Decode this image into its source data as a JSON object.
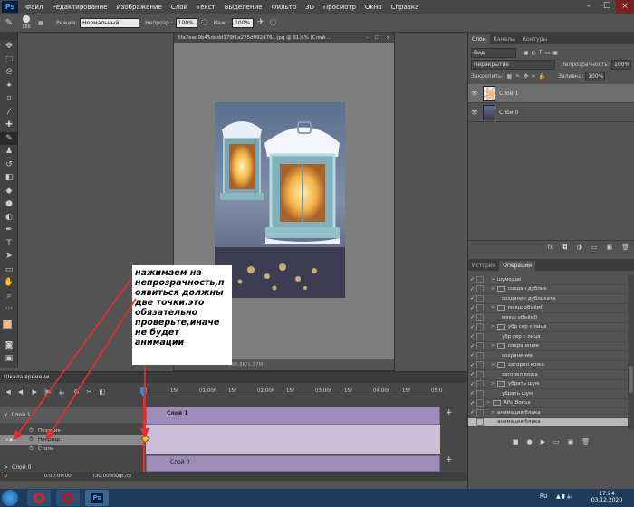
{
  "app": {
    "logo": "Ps"
  },
  "menu": [
    "Файл",
    "Редактирование",
    "Изображение",
    "Слои",
    "Текст",
    "Выделение",
    "Фильтр",
    "3D",
    "Просмотр",
    "Окно",
    "Справка"
  ],
  "options_bar": {
    "brush_size": "188",
    "mode_label": "Режим:",
    "mode_value": "Нормальный",
    "opacity_label": "Непрозр.:",
    "opacity_value": "100%",
    "pressure_label": "Наж.:",
    "pressure_value": "100%"
  },
  "document": {
    "title": "5fa7ead9b45dadd179f1a225d0924761.jpg @ 61,6% (Слой ...",
    "status": "798.8K/1.37M"
  },
  "layers_panel": {
    "tabs": [
      "Слои",
      "Каналы",
      "Контуры"
    ],
    "kind": "Вид",
    "blend": "Перекрытие",
    "opacity_label": "Непрозрачность:",
    "opacity_value": "100%",
    "lock_label": "Закрепить:",
    "fill_label": "Заливка:",
    "fill_value": "100%",
    "layers": [
      {
        "name": "Слой 1",
        "selected": true
      },
      {
        "name": "Слой 0",
        "selected": false
      }
    ],
    "footer_icons": [
      "fx",
      "◘",
      "◑",
      "▭",
      "▣",
      "🗑"
    ]
  },
  "actions_panel": {
    "tabs": [
      "История",
      "Операции"
    ],
    "items": [
      {
        "label": "шумодав",
        "indent": 1,
        "folder": false
      },
      {
        "label": "создан дублик",
        "indent": 1,
        "folder": true
      },
      {
        "label": "создание дубликата",
        "indent": 2,
        "folder": false
      },
      {
        "label": "мякш объём0",
        "indent": 1,
        "folder": true
      },
      {
        "label": "мякш объём0",
        "indent": 2,
        "folder": false
      },
      {
        "label": "убр сер с лица",
        "indent": 1,
        "folder": true
      },
      {
        "label": "убр сер с лица",
        "indent": 2,
        "folder": false
      },
      {
        "label": "сохранение",
        "indent": 1,
        "folder": true
      },
      {
        "label": "сохранение",
        "indent": 2,
        "folder": false
      },
      {
        "label": "загорел кожа",
        "indent": 1,
        "folder": true
      },
      {
        "label": "загорел кожа",
        "indent": 2,
        "folder": false
      },
      {
        "label": "убрать шум",
        "indent": 1,
        "folder": true
      },
      {
        "label": "убрать шум",
        "indent": 2,
        "folder": false
      },
      {
        "label": "APs_Bonus",
        "indent": 0,
        "folder": true
      },
      {
        "label": "анимация блика",
        "indent": 1,
        "folder": false
      },
      {
        "label": "анимация блика",
        "indent": 1,
        "folder": false,
        "selected": true
      }
    ]
  },
  "timeline": {
    "title": "Шкала времени",
    "ruler": [
      "15f",
      "01:00f",
      "15f",
      "02:00f",
      "15f",
      "03:00f",
      "15f",
      "04:00f",
      "15f",
      "05:0"
    ],
    "layer1": "Слой 1",
    "layer0": "Слой 0",
    "props": [
      "Позиция",
      "Непрозр.",
      "Стиль"
    ],
    "clip1": "Слой 1",
    "clip0": "Слой 0",
    "time": "0:00:00:00",
    "fps": "(30,00 кадр./с)"
  },
  "annotation": "нажимаем на непрозрачность,п оявиться должны две точки.это обязательно проверьте,иначе не будет анимации",
  "taskbar": {
    "lang": "RU",
    "time": "17:24",
    "date": "03.12.2020"
  },
  "colors": {
    "accent_red": "#e03030",
    "track": "#9d8bb8",
    "ps_blue": "#31a8ff"
  }
}
